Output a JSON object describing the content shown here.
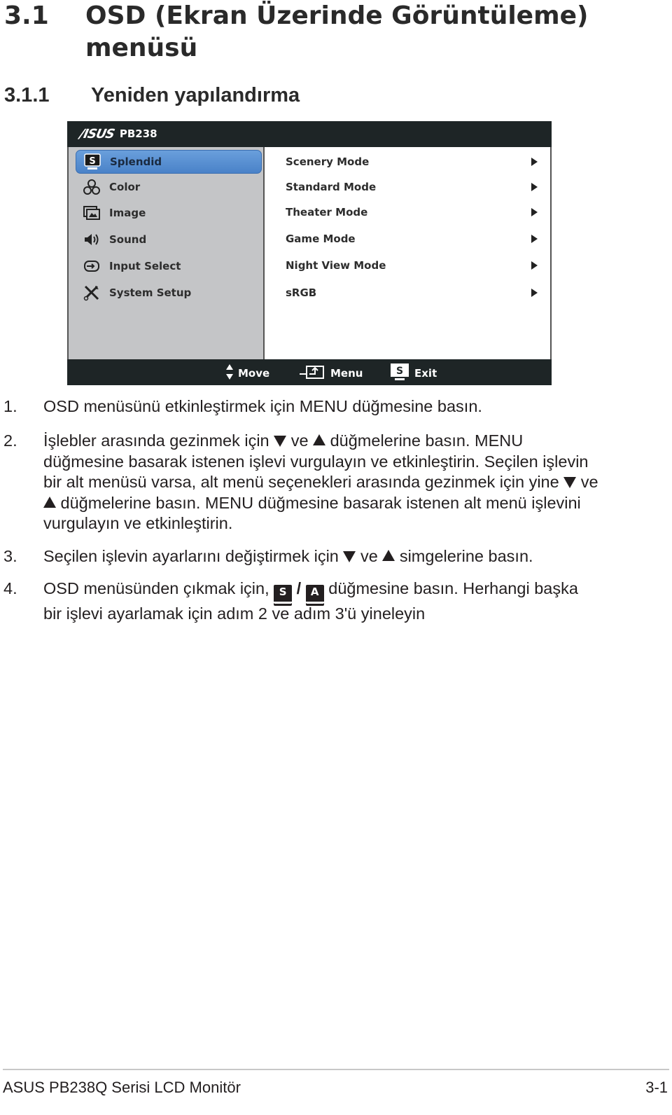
{
  "heading": {
    "section_number": "3.1",
    "section_title": "OSD (Ekran Üzerinde Görüntüleme) menüsü",
    "subsection_number": "3.1.1",
    "subsection_title": "Yeniden yapılandırma"
  },
  "osd": {
    "brand": "/ISUS",
    "model": "PB238",
    "main_menu": [
      {
        "label": "Splendid",
        "icon": "splendid-s-icon",
        "selected": true
      },
      {
        "label": "Color",
        "icon": "rgb-color-icon",
        "selected": false
      },
      {
        "label": "Image",
        "icon": "image-icon",
        "selected": false
      },
      {
        "label": "Sound",
        "icon": "speaker-icon",
        "selected": false
      },
      {
        "label": "Input Select",
        "icon": "input-select-icon",
        "selected": false
      },
      {
        "label": "System Setup",
        "icon": "wrench-screwdriver-icon",
        "selected": false
      }
    ],
    "sub_menu": [
      {
        "label": "Scenery Mode"
      },
      {
        "label": "Standard Mode"
      },
      {
        "label": "Theater Mode"
      },
      {
        "label": "Game Mode"
      },
      {
        "label": "Night View Mode"
      },
      {
        "label": "sRGB"
      }
    ],
    "footer": {
      "move_label": "Move",
      "menu_label": "Menu",
      "exit_label": "Exit",
      "exit_key": "S"
    },
    "colors": {
      "bar": "#1e2526",
      "left_panel": "#c4c5c7",
      "selected": "#5a90d2"
    }
  },
  "steps": [
    {
      "number": "1.",
      "lines": [
        "OSD menüsünü etkinleştirmek için MENU düğmesine basın."
      ]
    },
    {
      "number": "2.",
      "parts": {
        "a": "İşlebler arasında gezinmek için",
        "b": "ve",
        "c": "düğmelerine basın. MENU",
        "line2": "düğmesine basarak istenen işlevi vurgulayın ve etkinleştirin. Seçilen işlevin",
        "line3": "bir alt menüsü varsa, alt menü seçenekleri arasında gezinmek için yine",
        "line3b": "ve",
        "line4": "düğmelerine basın. MENU düğmesine basarak istenen alt menü işlevini",
        "line5": "vurgulayın ve etkinleştirin."
      }
    },
    {
      "number": "3.",
      "parts": {
        "a": "Seçilen işlevin ayarlarını değiştirmek için",
        "b": "ve",
        "c": "simgelerine basın."
      }
    },
    {
      "number": "4.",
      "parts": {
        "a": "OSD menüsünden çıkmak için,",
        "key1": "S",
        "slash": "/",
        "key2": "A",
        "b": "düğmesine basın. Herhangi başka",
        "line2": "bir işlevi ayarlamak için adım 2 ve adım 3'ü yineleyin"
      }
    }
  ],
  "footer": {
    "product": "ASUS PB238Q Serisi LCD Monitör",
    "page": "3-1"
  }
}
